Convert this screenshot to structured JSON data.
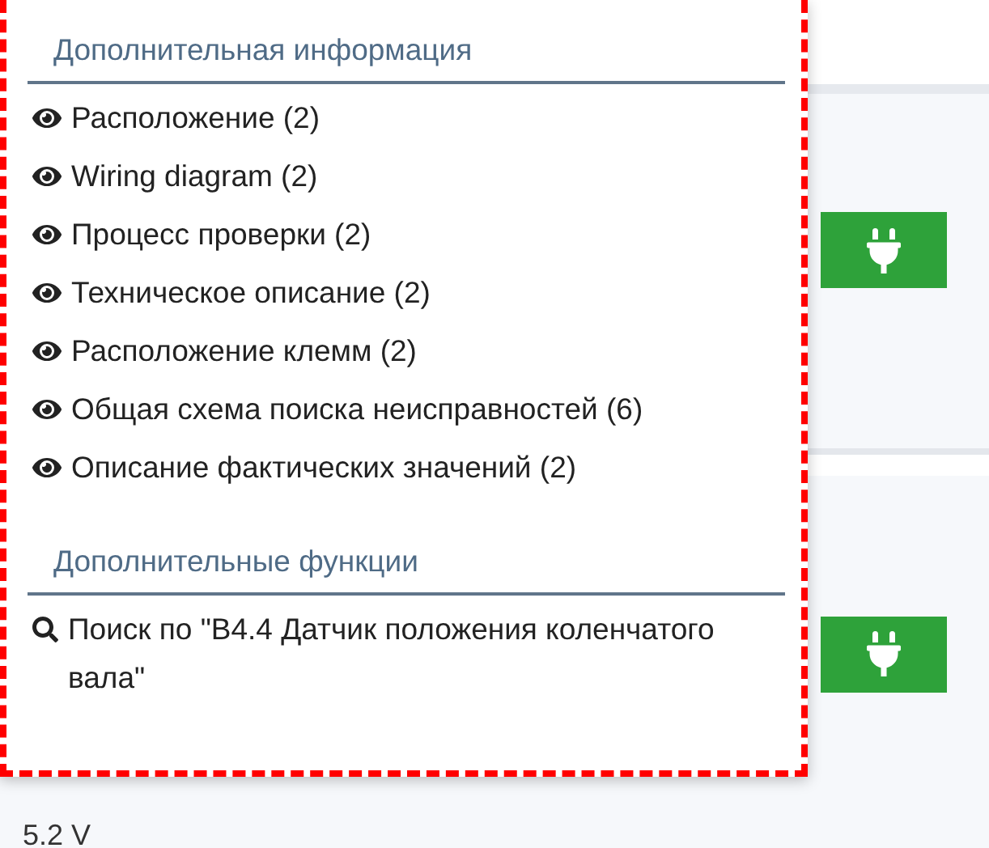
{
  "menu": {
    "sections": [
      {
        "title": "Дополнительная информация",
        "items": [
          {
            "kind": "view",
            "label": "Расположение (2)"
          },
          {
            "kind": "view",
            "label": "Wiring diagram (2)"
          },
          {
            "kind": "view",
            "label": "Процесс проверки (2)"
          },
          {
            "kind": "view",
            "label": "Техническое описание (2)"
          },
          {
            "kind": "view",
            "label": "Расположение клемм (2)"
          },
          {
            "kind": "view",
            "label": "Общая схема поиска неисправностей (6)"
          },
          {
            "kind": "view",
            "label": "Описание фактических значений (2)"
          }
        ]
      },
      {
        "title": "Дополнительные функции",
        "items": [
          {
            "kind": "search",
            "label": "Поиск по \"B4.4 Датчик положения коленчатого вала\""
          }
        ]
      }
    ]
  },
  "background": {
    "reading": "5.2 V"
  }
}
